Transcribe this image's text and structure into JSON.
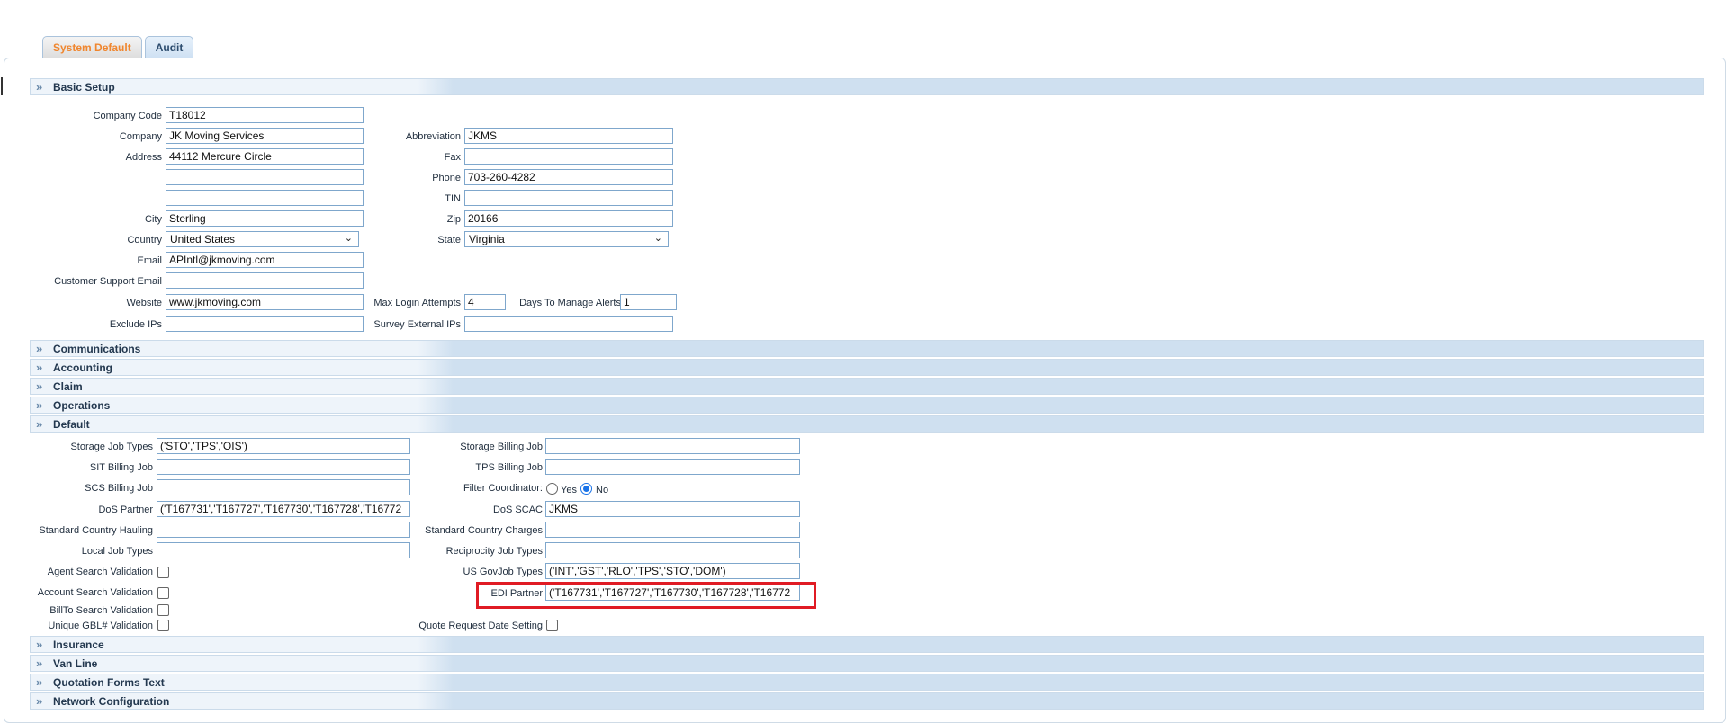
{
  "tabs": [
    "System Default",
    "Audit"
  ],
  "sections": {
    "basic_setup": "Basic Setup",
    "communications": "Communications",
    "accounting": "Accounting",
    "claim": "Claim",
    "operations": "Operations",
    "default": "Default",
    "insurance": "Insurance",
    "van_line": "Van Line",
    "quotation_forms_text": "Quotation Forms Text",
    "network_configuration": "Network Configuration"
  },
  "basic": {
    "company_code_label": "Company Code",
    "company_code": "T18012",
    "company_label": "Company",
    "company": "JK Moving Services",
    "abbreviation_label": "Abbreviation",
    "abbreviation": "JKMS",
    "address_label": "Address",
    "address1": "44112 Mercure Circle",
    "address2": "",
    "address3": "",
    "fax_label": "Fax",
    "fax": "",
    "phone_label": "Phone",
    "phone": "703-260-4282",
    "tin_label": "TIN",
    "tin": "",
    "city_label": "City",
    "city": "Sterling",
    "zip_label": "Zip",
    "zip": "20166",
    "country_label": "Country",
    "country": "United States",
    "state_label": "State",
    "state": "Virginia",
    "email_label": "Email",
    "email": "APIntl@jkmoving.com",
    "support_email_label": "Customer Support Email",
    "support_email": "",
    "website_label": "Website",
    "website": "www.jkmoving.com",
    "max_login_label": "Max Login Attempts",
    "max_login": "4",
    "days_alerts_label": "Days To Manage Alerts",
    "days_alerts": "1",
    "exclude_ips_label": "Exclude IPs",
    "exclude_ips": "",
    "survey_ips_label": "Survey External IPs",
    "survey_ips": ""
  },
  "default": {
    "storage_job_types_label": "Storage Job Types",
    "storage_job_types": "('STO','TPS','OIS')",
    "storage_billing_job_label": "Storage Billing Job",
    "storage_billing_job": "",
    "sit_billing_job_label": "SIT Billing Job",
    "sit_billing_job": "",
    "tps_billing_job_label": "TPS Billing Job",
    "tps_billing_job": "",
    "scs_billing_job_label": "SCS Billing Job",
    "scs_billing_job": "",
    "filter_coordinator_label": "Filter Coordinator:",
    "yes_label": "Yes",
    "no_label": "No",
    "dos_partner_label": "DoS Partner",
    "dos_partner": "('T167731','T167727','T167730','T167728','T16772",
    "dos_scac_label": "DoS SCAC",
    "dos_scac": "JKMS",
    "std_country_hauling_label": "Standard Country Hauling",
    "std_country_hauling": "",
    "std_country_charges_label": "Standard Country Charges",
    "std_country_charges": "",
    "local_job_types_label": "Local Job Types",
    "local_job_types": "",
    "reciprocity_job_types_label": "Reciprocity Job Types",
    "reciprocity_job_types": "",
    "agent_search_label": "Agent Search Validation",
    "us_gov_job_types_label": "US GovJob Types",
    "us_gov_job_types": "('INT','GST','RLO','TPS','STO','DOM')",
    "account_search_label": "Account Search Validation",
    "edi_partner_label": "EDI Partner",
    "edi_partner": "('T167731','T167727','T167730','T167728','T16772",
    "billto_search_label": "BillTo Search Validation",
    "unique_gbl_label": "Unique GBL# Validation",
    "quote_request_label": "Quote Request Date Setting"
  }
}
